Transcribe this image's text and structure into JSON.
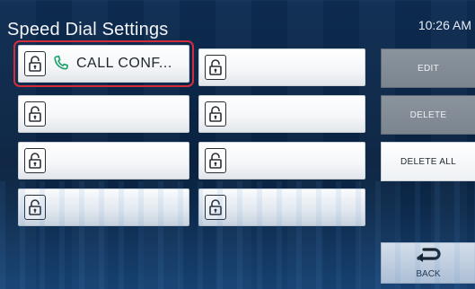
{
  "header": {
    "title": "Speed Dial Settings",
    "time": "10:26 AM"
  },
  "slots": [
    {
      "label": "CALL CONF...",
      "locked": true,
      "icon": "phone-icon",
      "selected": true
    },
    {
      "label": "",
      "locked": true,
      "icon": null,
      "selected": false
    },
    {
      "label": "",
      "locked": true,
      "icon": null,
      "selected": false
    },
    {
      "label": "",
      "locked": true,
      "icon": null,
      "selected": false
    },
    {
      "label": "",
      "locked": true,
      "icon": null,
      "selected": false
    },
    {
      "label": "",
      "locked": true,
      "icon": null,
      "selected": false
    },
    {
      "label": "",
      "locked": true,
      "icon": null,
      "selected": false
    },
    {
      "label": "",
      "locked": true,
      "icon": null,
      "selected": false
    }
  ],
  "actions": {
    "edit": "EDIT",
    "delete": "DELETE",
    "delete_all": "DELETE ALL",
    "back": "BACK"
  },
  "colors": {
    "selection_outline": "#d42d3a",
    "phone_icon": "#1fa36b",
    "disabled_button": "#8b949d"
  }
}
